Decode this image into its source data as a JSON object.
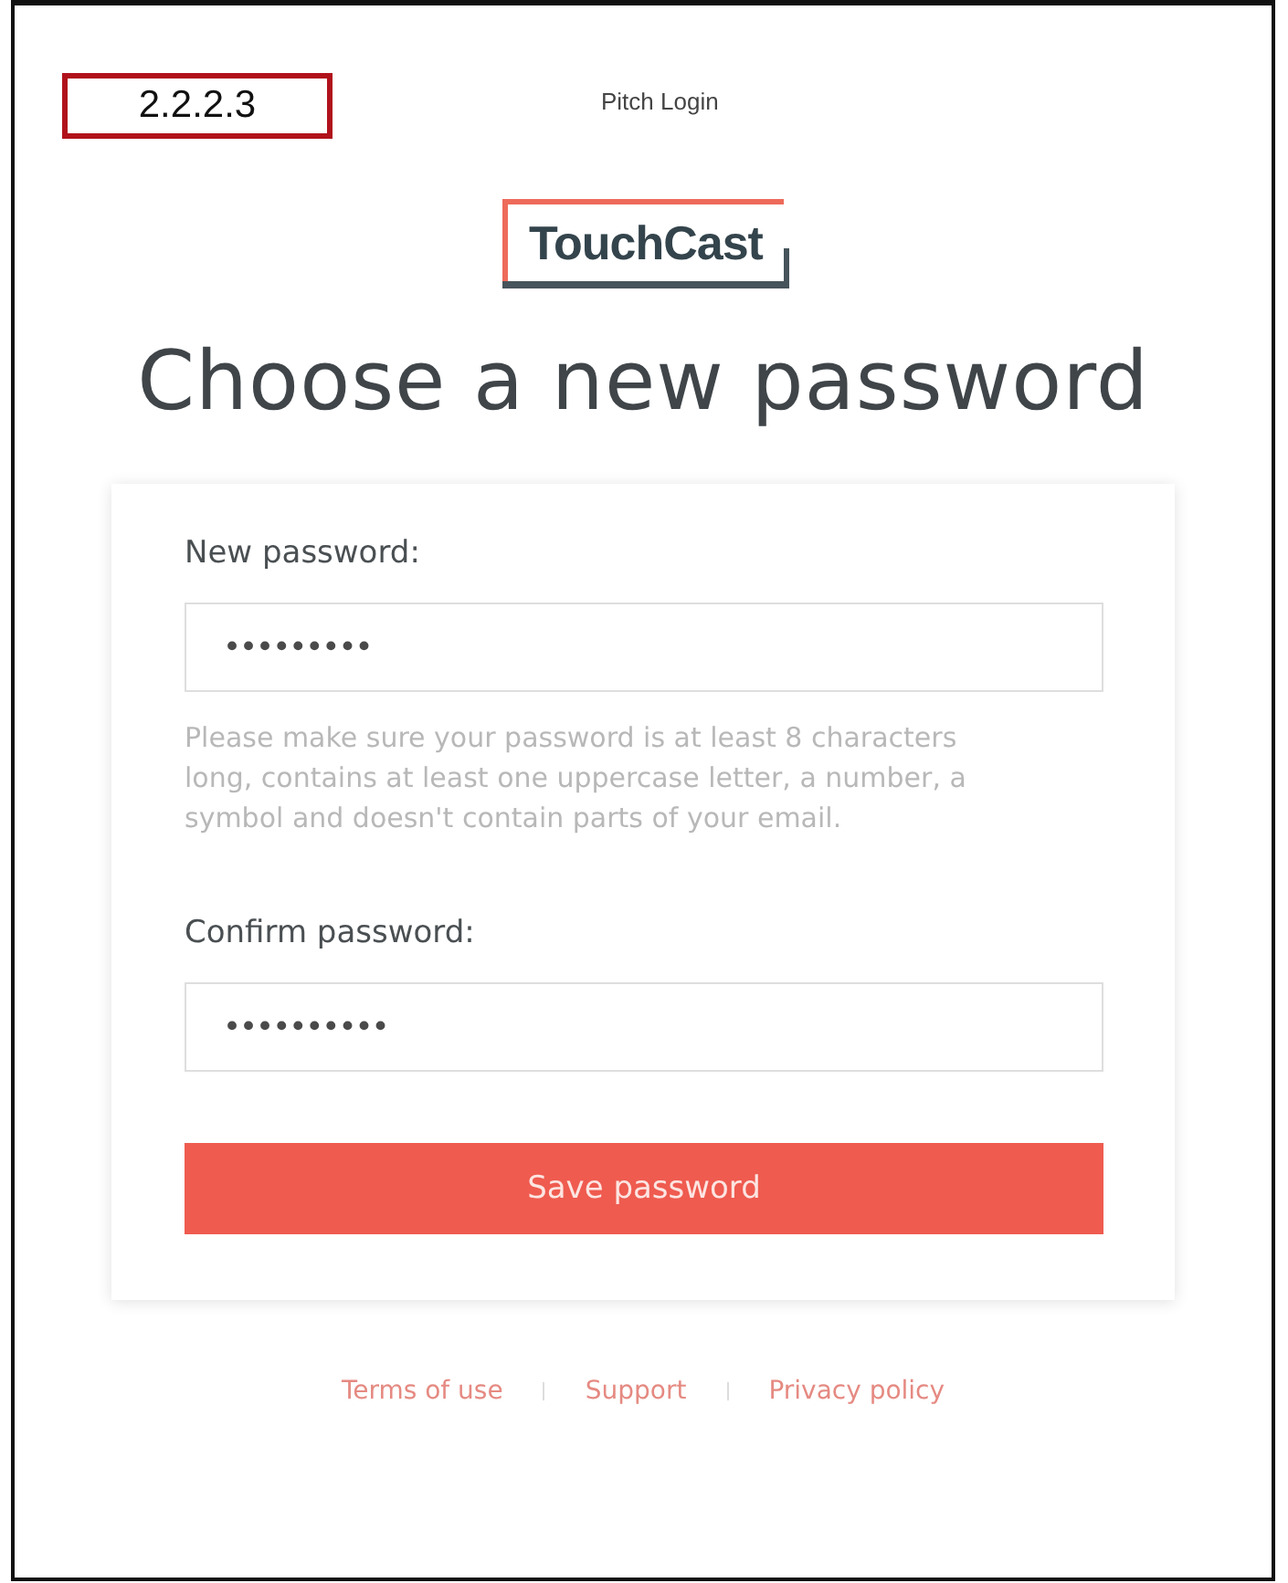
{
  "tag": "2.2.2.3",
  "page_title": "Pitch Login",
  "logo": "TouchCast",
  "heading": "Choose a new password",
  "form": {
    "fields": [
      {
        "label": "New password:",
        "value": "•••••••••",
        "hint": "Please make sure your password is at least 8 characters long, contains at least one uppercase letter, a number, a symbol and doesn't contain parts of your email."
      },
      {
        "label": "Confirm password:",
        "value": "••••••••••"
      }
    ],
    "button": "Save password"
  },
  "footer_links": [
    "Terms of use",
    "Support",
    "Privacy policy"
  ]
}
